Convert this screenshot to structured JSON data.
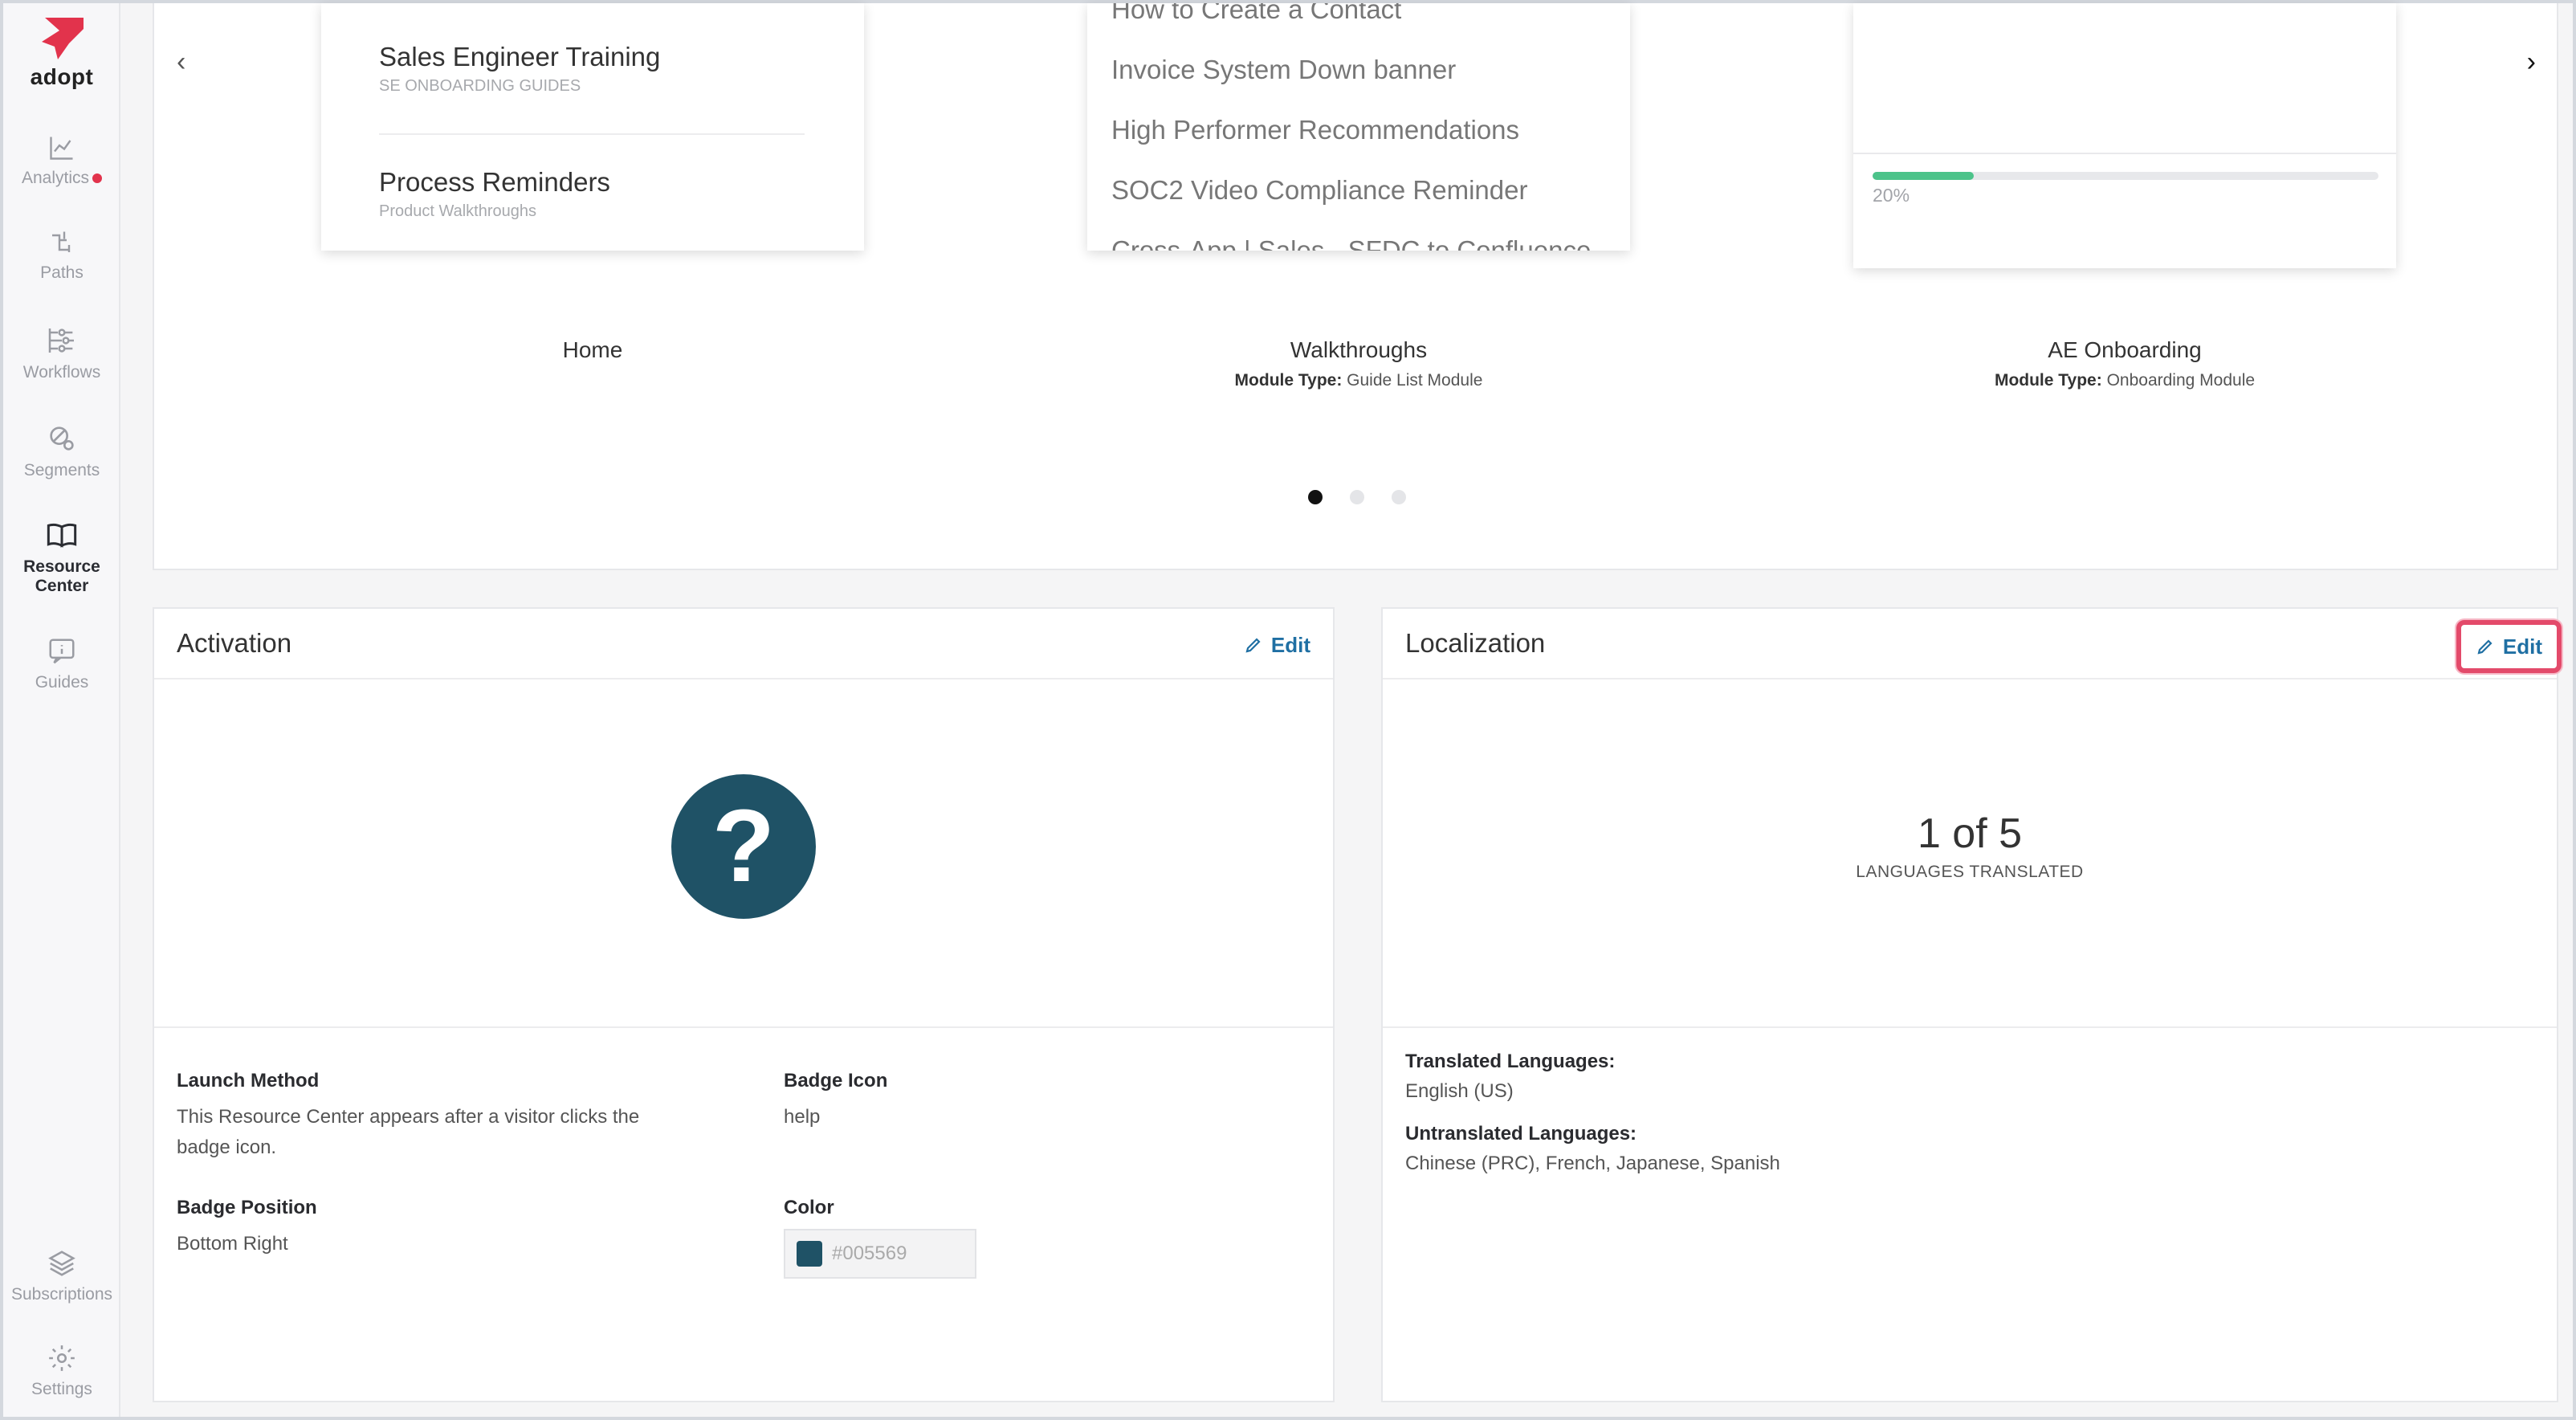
{
  "brand": {
    "name": "adopt",
    "accent": "#e2334c"
  },
  "sidebar": {
    "items": [
      {
        "label": "Analytics",
        "icon": "line-chart-icon",
        "badge_dot": true
      },
      {
        "label": "Paths",
        "icon": "paths-icon"
      },
      {
        "label": "Workflows",
        "icon": "workflows-icon"
      },
      {
        "label": "Segments",
        "icon": "segments-icon"
      },
      {
        "label": "Resource Center",
        "icon": "book-icon",
        "active": true
      },
      {
        "label": "Guides",
        "icon": "guide-icon"
      },
      {
        "label": "Subscriptions",
        "icon": "layers-icon"
      },
      {
        "label": "Settings",
        "icon": "gear-icon"
      }
    ]
  },
  "carousel": {
    "modules": [
      {
        "name": "Home",
        "items": [
          {
            "title": "Sales Engineer Training",
            "subtitle": "SE ONBOARDING GUIDES"
          },
          {
            "title": "Process Reminders",
            "subtitle": "Product Walkthroughs"
          }
        ]
      },
      {
        "name": "Walkthroughs",
        "type_label": "Module Type:",
        "type_value": "Guide List Module",
        "items": [
          "How to Create a Contact",
          "Invoice System Down banner",
          "High Performer Recommendations",
          "SOC2 Video Compliance Reminder",
          "Cross-App | Sales - SFDC to Confluence"
        ]
      },
      {
        "name": "AE Onboarding",
        "type_label": "Module Type:",
        "type_value": "Onboarding Module",
        "progress": 0.2,
        "progress_label": "20%",
        "progress_color": "#4cc38a"
      }
    ],
    "page_count": 3,
    "active_page": 1
  },
  "activation": {
    "title": "Activation",
    "edit_label": "Edit",
    "icon_glyph": "?",
    "launch_method_label": "Launch Method",
    "launch_method_value": "This Resource Center appears after a visitor clicks the badge icon.",
    "badge_icon_label": "Badge Icon",
    "badge_icon_value": "help",
    "badge_position_label": "Badge Position",
    "badge_position_value": "Bottom Right",
    "color_label": "Color",
    "color_value": "#005569",
    "color_swatch": "#1f5266"
  },
  "localization": {
    "title": "Localization",
    "edit_label": "Edit",
    "stat_value": "1 of 5",
    "stat_label": "LANGUAGES TRANSLATED",
    "translated_label": "Translated Languages:",
    "translated_value": "English (US)",
    "untranslated_label": "Untranslated Languages:",
    "untranslated_value": "Chinese (PRC), French, Japanese, Spanish"
  }
}
